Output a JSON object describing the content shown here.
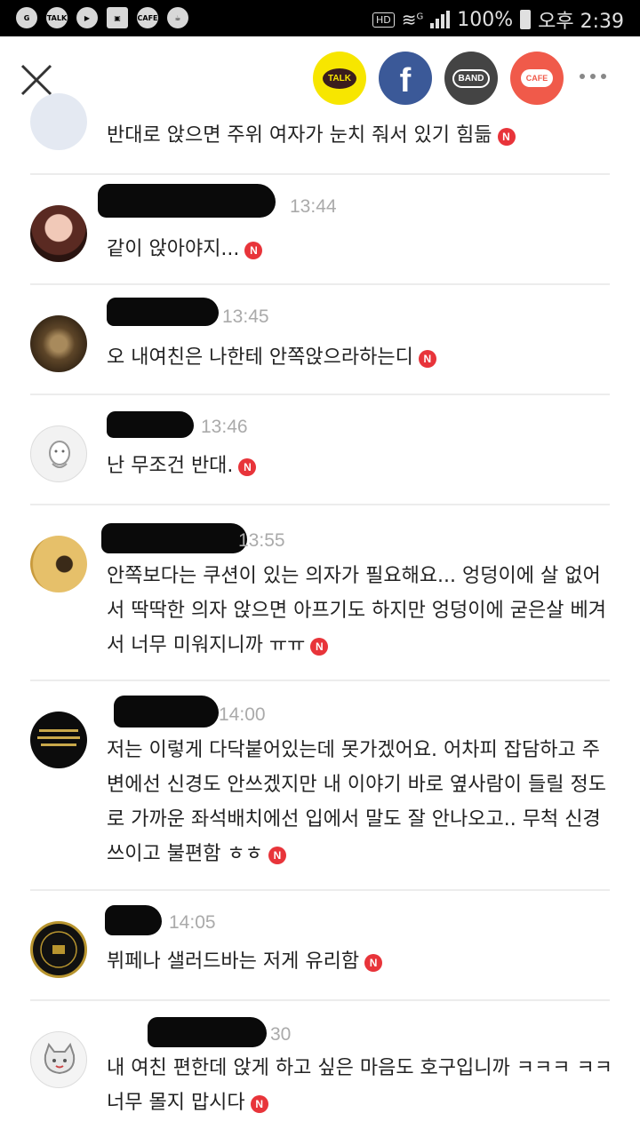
{
  "status_bar": {
    "left_icons": [
      "ring-icon",
      "talk-icon",
      "play-icon",
      "gallery-icon",
      "cafe-icon",
      "coffee-icon"
    ],
    "talk_label": "TALK",
    "cafe_label": "CAFE",
    "hd": "HD",
    "network": "G",
    "battery": "100%",
    "time": "오후 2:39"
  },
  "top_bar": {
    "share_talk": "TALK",
    "share_facebook": "f",
    "share_band": "BAND",
    "share_cafe": "CAFE"
  },
  "comments": [
    {
      "time": "",
      "text": "반대로 앉으면 주위 여자가 눈치 줘서 있기 힘듦",
      "badge": "N"
    },
    {
      "time": "13:44",
      "text": "같이 앉아야지...",
      "badge": "N"
    },
    {
      "time": "13:45",
      "text": "오 내여친은 나한테 안쪽앉으라하는디",
      "badge": "N"
    },
    {
      "time": "13:46",
      "text": "난 무조건 반대.",
      "badge": "N"
    },
    {
      "time": "13:55",
      "text": "안쪽보다는 쿠션이 있는 의자가 필요해요... 엉덩이에 살 없어서 딱딱한 의자 앉으면 아프기도 하지만 엉덩이에 굳은살 베겨서 너무 미워지니까 ㅠㅠ",
      "badge": "N"
    },
    {
      "time": "14:00",
      "text": "저는 이렇게 다닥붙어있는데 못가겠어요. 어차피 잡담하고 주변에선 신경도 안쓰겠지만 내 이야기 바로 옆사람이 들릴 정도로 가까운 좌석배치에선 입에서 말도 잘 안나오고.. 무척 신경쓰이고 불편함 ㅎㅎ",
      "badge": "N"
    },
    {
      "time": "14:05",
      "text": "뷔페나 샐러드바는 저게 유리함",
      "badge": "N"
    },
    {
      "time": "30",
      "text": "내 여친 편한데 앉게 하고 싶은 마음도 호구입니까 ㅋㅋㅋ ㅋㅋ 너무 몰지 맙시다",
      "badge": "N"
    }
  ]
}
